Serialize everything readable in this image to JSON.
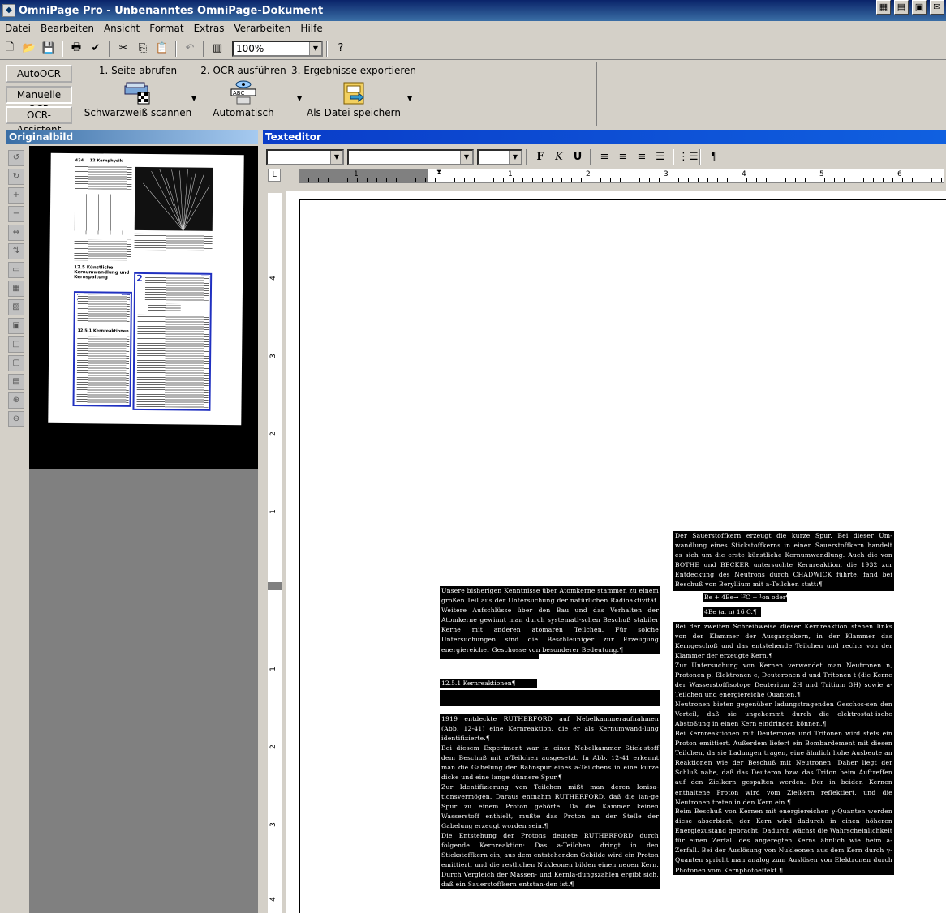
{
  "window": {
    "title": "OmniPage Pro - Unbenanntes OmniPage-Dokument"
  },
  "menu": [
    "Datei",
    "Bearbeiten",
    "Ansicht",
    "Format",
    "Extras",
    "Verarbeiten",
    "Hilfe"
  ],
  "toolbar": {
    "zoom": "100%"
  },
  "ocr_toolbar": {
    "buttons": [
      "AutoOCR",
      "Manuelle OCR",
      "OCR-Assistent"
    ],
    "step1": {
      "label": "1. Seite abrufen",
      "action": "Schwarzweiß scannen"
    },
    "step2": {
      "label": "2. OCR ausführen",
      "action": "Automatisch"
    },
    "step3": {
      "label": "3. Ergebnisse exportieren",
      "action": "Als Datei speichern"
    }
  },
  "original_panel": {
    "title": "Originalbild",
    "page_header": "12 Kernphysik",
    "page_number": "434",
    "section_heading": "12.5 Künstliche Kernumwandlung und Kernspaltung",
    "subsection_heading": "12.5.1 Kernreaktionen",
    "zones": [
      "1",
      "2"
    ]
  },
  "editor": {
    "title": "Texteditor",
    "format_buttons": {
      "bold": "F",
      "italic": "K",
      "underline": "U",
      "pilcrow": "¶"
    },
    "ruler_numbers": [
      "1",
      "1",
      "2",
      "3",
      "4",
      "5",
      "6"
    ],
    "vruler_numbers": [
      "4",
      "3",
      "2",
      "1",
      "1",
      "2",
      "3",
      "4"
    ],
    "col1": {
      "para1": "Unsere bisherigen Kenntnisse über Atomkerne stammen zu einem großen Teil aus der Untersuchung der natürlichen Radioaktivität. Weitere Aufschlüsse über den Bau und das Verhalten der Atomkerne gewinnt man durch systemati-schen Beschuß stabiler Kerne mit anderen atomaren Teilchen. Für solche Untersuchungen sind die Beschleuniger zur Erzeugung energiereicher Geschosse von besonderer Bedeutung.¶",
      "heading": "12.5.1 Kernreaktionen¶",
      "para2": "1919 entdeckte RUTHERFORD auf Nebelkammeraufnahmen (Abb. 12-41) eine Kernreaktion, die er als Kernumwand-lung identifizierte.¶",
      "para3": "Bei diesem Experiment war in einer Nebelkammer Stick-stoff dem Beschuß mit a-Teilchen ausgesetzt. In Abb. 12-41 erkennt man die Gabelung der Bahnspur eines a-Teilchens in eine kurze dicke und eine lange dünnere Spur.¶",
      "para4": "Zur Identifizierung von Teilchen mißt man deren Ionisa-tionsvermögen. Daraus entnahm RUTHERFORD, daß die lan-ge Spur zu einem Proton gehörte. Da die Kammer keinen Wasserstoff enthielt, mußte das Proton an der Stelle der Gabelung erzeugt worden sein.¶",
      "para5": "Die Entstehung der Protons deutete RUTHERFORD durch folgende Kernreaktion: Das a-Teilchen dringt in den Stickstoffkern ein, aus dem entstehenden Gebilde wird ein Proton emittiert, und die restlichen Nukleonen bilden einen neuen Kern. Durch Vergleich der Massen- und Kernla-dungszahlen ergibt sich, daß ein Sauerstoffkern entstan-den ist.¶"
    },
    "col2": {
      "para1": "Der Sauerstoffkern erzeugt die kurze Spur. Bei dieser Um-wandlung eines Stickstoffkerns in einen Sauerstoffkern handelt es sich um die erste künstliche Kernumwandlung. Auch die von BOTHE und BECKER untersuchte Kernreaktion, die 1932 zur Entdeckung des Neutrons durch CHADWICK führte, fand bei Beschuß von Beryllium mit a-Teilchen statt:¶",
      "formula1": "Be + 4Be→ ¹²C + ¹on oder¶",
      "formula2": "4Be (a, n) 16 C.¶",
      "para2": "Bei der zweiten Schreibweise dieser Kernreaktion stehen links von der Klammer der Ausgangskern, in der Klammer das Kerngeschoß und das entstehende Teilchen und rechts von der Klammer der erzeugte Kern.¶",
      "para3": "Zur Untersuchung von Kernen verwendet man Neutronen n, Protonen p, Elektronen e, Deuteronen d und Tritonen t (die Kerne der Wasserstoffisotope Deuterium 2H und Tritium 3H) sowie a-Teilchen und energiereiche Quanten.¶",
      "para4": "Neutronen bieten gegenüber ladungstragenden Geschos-sen den Vorteil, daß sie ungehemmt durch die elektrostat-ische Abstoßung in einen Kern eindringen können.¶",
      "para5": "Bei Kernreaktionen mit Deuteronen und Tritonen wird stets ein Proton emittiert. Außerdem liefert ein Bombardement mit diesen Teilchen, da sie Ladungen tragen, eine ähnlich hohe Ausbeute an Reaktionen wie der Beschuß mit Neutronen. Daher liegt der Schluß nahe, daß das Deuteron bzw. das Triton beim Auftreffen auf den Zielkern gespalten werden. Der in beiden Kernen enthaltene Proton wird vom Zielkern reflektiert, und die Neutronen treten in den Kern ein.¶",
      "para6": "Beim Beschuß von Kernen mit energiereichen γ-Quanten werden diese absorbiert, der Kern wird dadurch in einen höheren Energiezustand gebracht. Dadurch wächst die Wahrscheinlichkeit für einen Zerfall des angeregten Kerns ähnlich wie beim a-Zerfall. Bei der Auslösung von Nukleonen aus dem Kern durch γ-Quanten spricht man analog zum Auslösen von Elektronen durch Photonen vom Kernphotoeffekt.¶"
    }
  }
}
